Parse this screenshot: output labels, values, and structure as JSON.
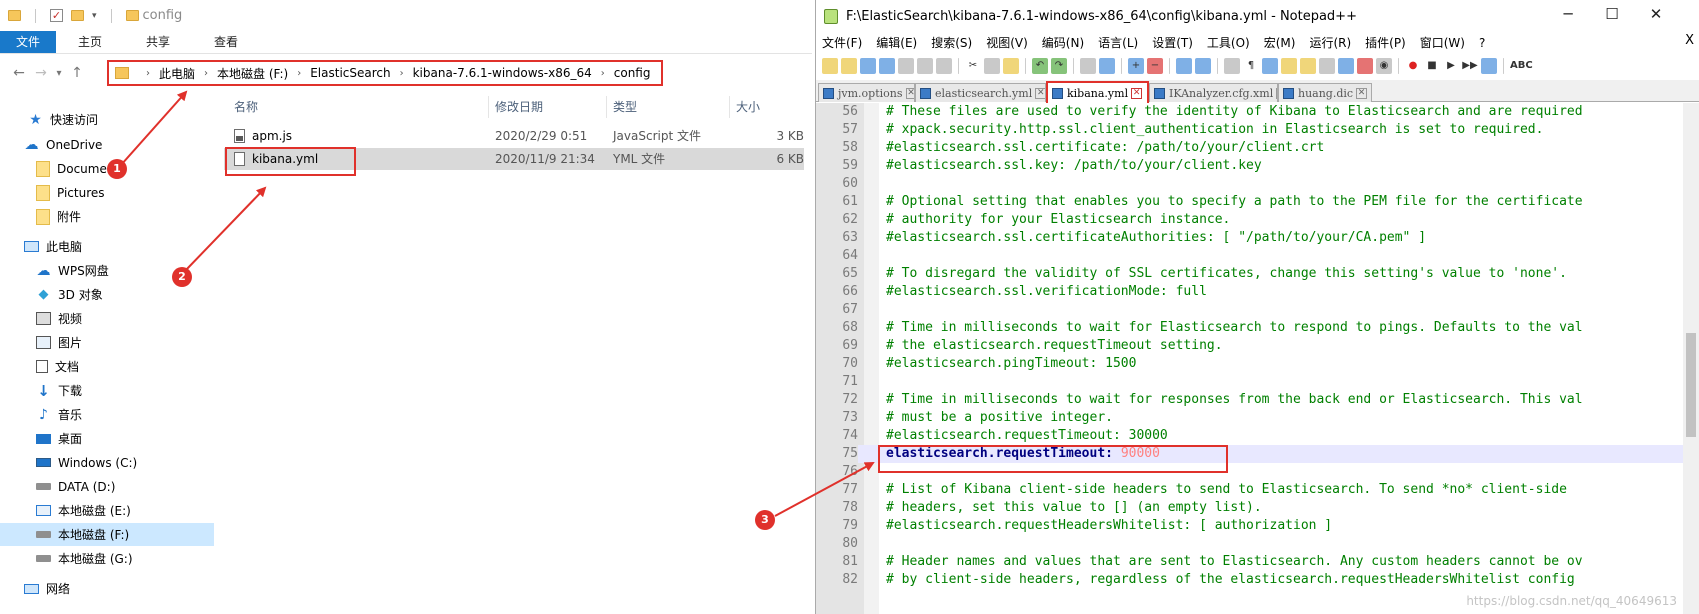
{
  "explorer": {
    "title": "config",
    "ribbon_tabs": [
      "文件",
      "主页",
      "共享",
      "查看"
    ],
    "breadcrumb": [
      "此电脑",
      "本地磁盘 (F:)",
      "ElasticSearch",
      "kibana-7.6.1-windows-x86_64",
      "config"
    ],
    "nav": [
      {
        "label": "快速访问",
        "icon": "star-icon"
      },
      {
        "label": "OneDrive",
        "icon": "cloud-icon"
      },
      {
        "label": "Documents",
        "icon": "folder-icon"
      },
      {
        "label": "Pictures",
        "icon": "folder-icon"
      },
      {
        "label": "附件",
        "icon": "folder-icon"
      },
      {
        "label": "此电脑",
        "icon": "computer-icon"
      },
      {
        "label": "WPS网盘",
        "icon": "cloud-icon"
      },
      {
        "label": "3D 对象",
        "icon": "cube-icon"
      },
      {
        "label": "视频",
        "icon": "video-icon"
      },
      {
        "label": "图片",
        "icon": "image-icon"
      },
      {
        "label": "文档",
        "icon": "document-icon"
      },
      {
        "label": "下载",
        "icon": "download-icon"
      },
      {
        "label": "音乐",
        "icon": "music-icon"
      },
      {
        "label": "桌面",
        "icon": "desktop-icon"
      },
      {
        "label": "Windows (C:)",
        "icon": "windows-drive-icon"
      },
      {
        "label": "DATA (D:)",
        "icon": "drive-icon"
      },
      {
        "label": "本地磁盘 (E:)",
        "icon": "drive-icon"
      },
      {
        "label": "本地磁盘 (F:)",
        "icon": "drive-icon"
      },
      {
        "label": "本地磁盘 (G:)",
        "icon": "drive-icon"
      },
      {
        "label": "网络",
        "icon": "network-icon"
      }
    ],
    "columns": [
      "名称",
      "修改日期",
      "类型",
      "大小"
    ],
    "files": [
      {
        "name": "apm.js",
        "date": "2020/2/29 0:51",
        "type": "JavaScript 文件",
        "size": "3 KB"
      },
      {
        "name": "kibana.yml",
        "date": "2020/11/9 21:34",
        "type": "YML 文件",
        "size": "6 KB"
      }
    ]
  },
  "notepad": {
    "title": "F:\\ElasticSearch\\kibana-7.6.1-windows-x86_64\\config\\kibana.yml - Notepad++",
    "menu": [
      "文件(F)",
      "编辑(E)",
      "搜索(S)",
      "视图(V)",
      "编码(N)",
      "语言(L)",
      "设置(T)",
      "工具(O)",
      "宏(M)",
      "运行(R)",
      "插件(P)",
      "窗口(W)",
      "?"
    ],
    "tabs": [
      "jvm.options",
      "elasticsearch.yml",
      "kibana.yml",
      "IKAnalyzer.cfg.xml",
      "huang.dic"
    ],
    "lines": [
      {
        "n": "56",
        "t": "# These files are used to verify the identity of Kibana to Elasticsearch and are required"
      },
      {
        "n": "57",
        "t": "# xpack.security.http.ssl.client_authentication in Elasticsearch is set to required."
      },
      {
        "n": "58",
        "t": "#elasticsearch.ssl.certificate: /path/to/your/client.crt"
      },
      {
        "n": "59",
        "t": "#elasticsearch.ssl.key: /path/to/your/client.key"
      },
      {
        "n": "60",
        "t": ""
      },
      {
        "n": "61",
        "t": "# Optional setting that enables you to specify a path to the PEM file for the certificate"
      },
      {
        "n": "62",
        "t": "# authority for your Elasticsearch instance."
      },
      {
        "n": "63",
        "t": "#elasticsearch.ssl.certificateAuthorities: [ \"/path/to/your/CA.pem\" ]"
      },
      {
        "n": "64",
        "t": ""
      },
      {
        "n": "65",
        "t": "# To disregard the validity of SSL certificates, change this setting's value to 'none'."
      },
      {
        "n": "66",
        "t": "#elasticsearch.ssl.verificationMode: full"
      },
      {
        "n": "67",
        "t": ""
      },
      {
        "n": "68",
        "t": "# Time in milliseconds to wait for Elasticsearch to respond to pings. Defaults to the val"
      },
      {
        "n": "69",
        "t": "# the elasticsearch.requestTimeout setting."
      },
      {
        "n": "70",
        "t": "#elasticsearch.pingTimeout: 1500"
      },
      {
        "n": "71",
        "t": ""
      },
      {
        "n": "72",
        "t": "# Time in milliseconds to wait for responses from the back end or Elasticsearch. This val"
      },
      {
        "n": "73",
        "t": "# must be a positive integer."
      },
      {
        "n": "74",
        "t": "#elasticsearch.requestTimeout: 30000"
      },
      {
        "n": "75",
        "t": ""
      },
      {
        "n": "76",
        "t": ""
      },
      {
        "n": "77",
        "t": "# List of Kibana client-side headers to send to Elasticsearch. To send *no* client-side"
      },
      {
        "n": "78",
        "t": "# headers, set this value to [] (an empty list)."
      },
      {
        "n": "79",
        "t": "#elasticsearch.requestHeadersWhitelist: [ authorization ]"
      },
      {
        "n": "80",
        "t": ""
      },
      {
        "n": "81",
        "t": "# Header names and values that are sent to Elasticsearch. Any custom headers cannot be ov"
      },
      {
        "n": "82",
        "t": "# by client-side headers, regardless of the elasticsearch.requestHeadersWhitelist config"
      }
    ],
    "line75": {
      "key": "elasticsearch.requestTimeout:",
      "value": "90000"
    },
    "watermark": "https://blog.csdn.net/qq_40649613"
  },
  "badges": [
    "1",
    "2",
    "3"
  ],
  "colors": {
    "accent": "#1979ca",
    "annotation": "#e0312b",
    "comment": "#008000"
  }
}
